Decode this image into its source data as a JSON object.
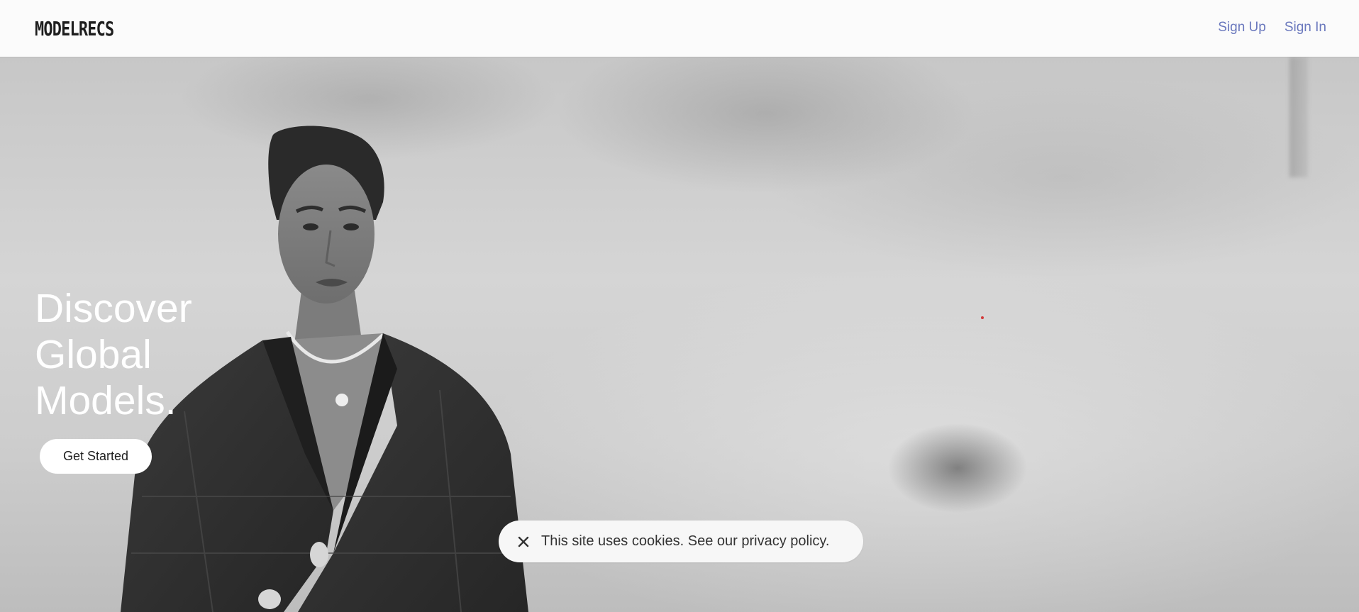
{
  "header": {
    "logo": "MODELRECS",
    "links": [
      {
        "label": "Sign Up"
      },
      {
        "label": "Sign In"
      }
    ]
  },
  "hero": {
    "heading_lines": [
      "Discover",
      "Global",
      "Models."
    ],
    "cta_label": "Get Started"
  },
  "cookie_banner": {
    "text": "This site uses cookies. See our privacy policy.",
    "close_icon": "close-icon"
  },
  "colors": {
    "nav_link": "#6a78bd",
    "logo": "#1e1e1e",
    "hero_text": "#ffffff",
    "button_bg": "#ffffff",
    "banner_bg": "#f7f7f7"
  }
}
